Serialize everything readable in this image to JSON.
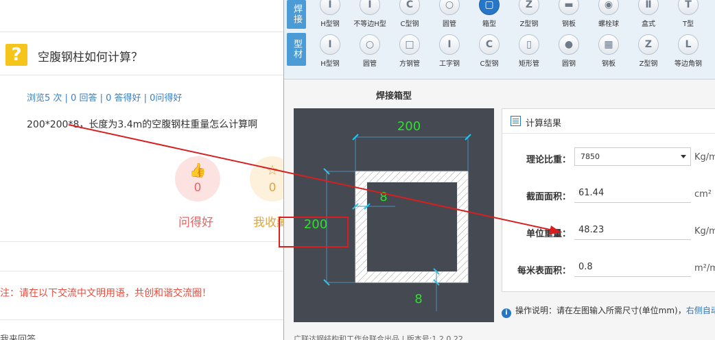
{
  "left": {
    "question_title": "空腹钢柱如何计算？",
    "stats": "浏览5 次 | 0 回答 | 0 答得好 | 0问得好",
    "question_text": "200*200*8，长度为3.4m的空腹钢柱重量怎么计算啊",
    "reactions": [
      {
        "count": "0",
        "label": "问得好"
      },
      {
        "count": "0",
        "label": "我收藏"
      }
    ],
    "notice": "注：请在以下交流中文明用语，共创和谐交流圈！",
    "bottom_text": "我来回答"
  },
  "app": {
    "categories": [
      "焊接",
      "型材"
    ],
    "welded_tools": [
      "H型钢",
      "不等边H型",
      "C型钢",
      "圆管",
      "箱型",
      "Z型钢",
      "钢板",
      "螺栓球",
      "盒式",
      "T型"
    ],
    "profile_tools": [
      "H型钢",
      "圆管",
      "方钢管",
      "工字钢",
      "C型钢",
      "矩形管",
      "圆钢",
      "钢板",
      "Z型钢",
      "等边角钢"
    ],
    "section_title": "焊接箱型",
    "dims": {
      "width": "200",
      "height": "200",
      "thickness_left": "8",
      "thickness_bottom": "8"
    },
    "result": {
      "title": "计算结果",
      "density_label": "理论比重：",
      "density_value": "7850",
      "density_unit": "Kg/m",
      "area_label": "截面面积：",
      "area_value": "61.44",
      "area_unit": "cm²",
      "weight_label": "单位重量：",
      "weight_value": "48.23",
      "weight_unit": "Kg/m",
      "surface_label": "每米表面积：",
      "surface_value": "0.8",
      "surface_unit": "m²/m"
    },
    "info_text": "操作说明：请在左图输入所需尺寸(单位mm)，",
    "info_link": "右侧自动",
    "footer": "广联达钢结构和工作台联合出品  |  版本号:1.2.0.22"
  }
}
